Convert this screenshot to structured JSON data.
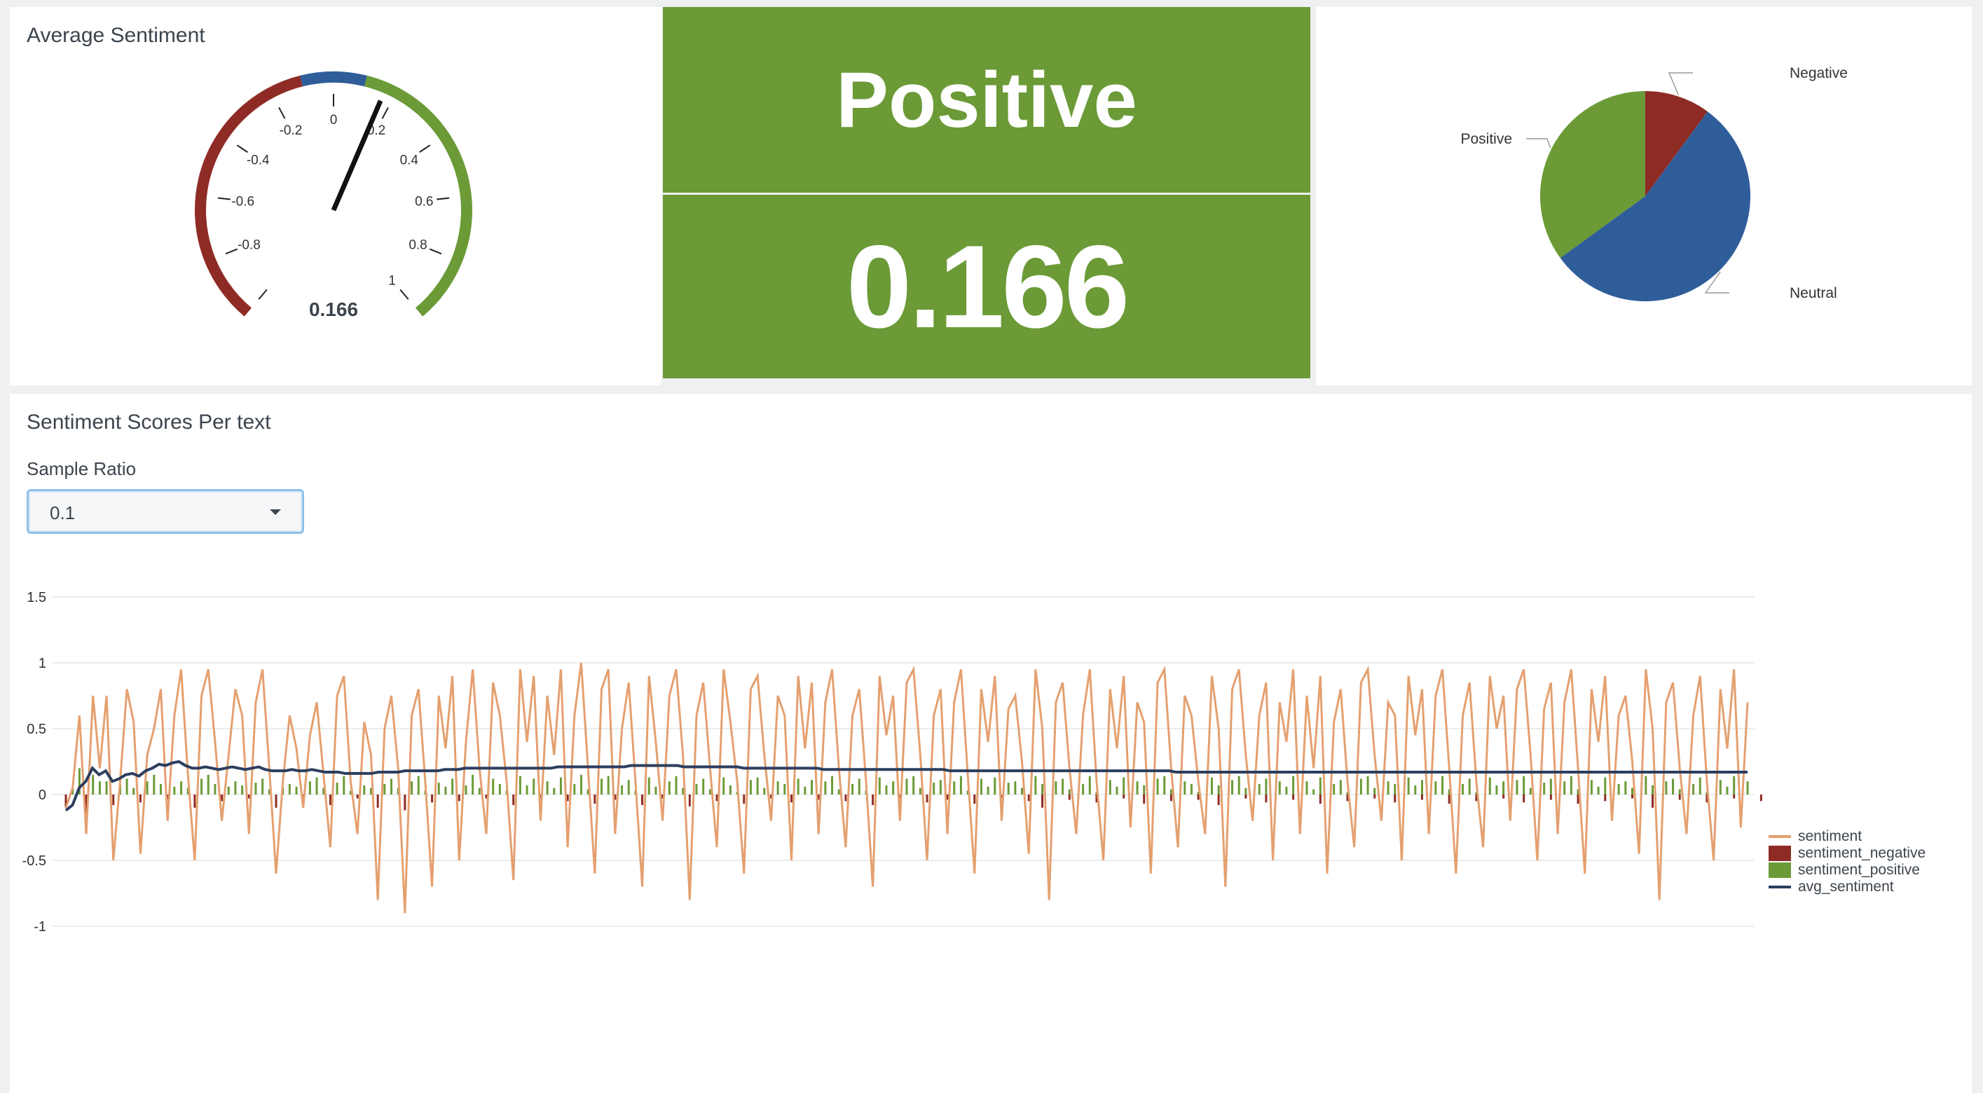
{
  "gauge": {
    "title": "Average Sentiment",
    "value": 0.166,
    "value_label": "0.166",
    "min": -1,
    "max": 1,
    "ticks": [
      "-1",
      "-0.8",
      "-0.6",
      "-0.4",
      "-0.2",
      "0",
      "0.2",
      "0.4",
      "0.6",
      "0.8",
      "1"
    ],
    "bands": [
      {
        "from": -1,
        "to": -0.1,
        "color": "#8f2b25"
      },
      {
        "from": -0.1,
        "to": 0.1,
        "color": "#2f5d9a"
      },
      {
        "from": 0.1,
        "to": 1,
        "color": "#6b9a37"
      }
    ]
  },
  "single_value": {
    "label": "Positive",
    "value": "0.166",
    "color": "#6b9a37"
  },
  "pie": {
    "slices": [
      {
        "label": "Negative",
        "fraction": 0.101,
        "color": "#8f2b25"
      },
      {
        "label": "Neutral",
        "fraction": 0.549,
        "color": "#2f5d9a"
      },
      {
        "label": "Positive",
        "fraction": 0.35,
        "color": "#6b9a37"
      }
    ]
  },
  "timeline": {
    "title": "Sentiment Scores Per text",
    "sample_ratio_label": "Sample Ratio",
    "sample_ratio_value": "0.1"
  },
  "chart_data": {
    "type": "line",
    "y_ticks": [
      "1.5",
      "1",
      "0.5",
      "0",
      "-0.5",
      "-1"
    ],
    "ylim": [
      -1,
      1.5
    ],
    "grid": true,
    "legend_position": "right",
    "series": [
      {
        "name": "sentiment",
        "color": "#e4a06f",
        "type": "line"
      },
      {
        "name": "sentiment_negative",
        "color": "#8f2b25",
        "type": "bar"
      },
      {
        "name": "sentiment_positive",
        "color": "#6b9a37",
        "type": "bar"
      },
      {
        "name": "avg_sentiment",
        "color": "#2c3e5f",
        "type": "line"
      }
    ],
    "sentiment": [
      -0.1,
      0.05,
      0.6,
      -0.3,
      0.75,
      0.2,
      0.75,
      -0.5,
      0.1,
      0.8,
      0.55,
      -0.45,
      0.3,
      0.5,
      0.8,
      -0.2,
      0.6,
      0.95,
      0.15,
      -0.5,
      0.75,
      0.95,
      0.4,
      -0.2,
      0.3,
      0.8,
      0.6,
      -0.3,
      0.7,
      0.95,
      0.2,
      -0.6,
      0.1,
      0.6,
      0.35,
      -0.1,
      0.45,
      0.7,
      0.15,
      -0.4,
      0.75,
      0.9,
      0.1,
      -0.3,
      0.55,
      0.3,
      -0.8,
      0.5,
      0.75,
      0.2,
      -0.9,
      0.6,
      0.8,
      0.1,
      -0.7,
      0.75,
      0.35,
      0.9,
      -0.5,
      0.4,
      0.95,
      0.2,
      -0.3,
      0.85,
      0.6,
      0.1,
      -0.65,
      0.95,
      0.4,
      0.9,
      -0.2,
      0.75,
      0.3,
      0.95,
      -0.4,
      0.6,
      1.0,
      0.2,
      -0.6,
      0.8,
      0.95,
      -0.3,
      0.5,
      0.85,
      0.1,
      -0.7,
      0.9,
      0.4,
      -0.2,
      0.75,
      0.95,
      0.3,
      -0.8,
      0.6,
      0.85,
      0.2,
      -0.4,
      0.95,
      0.55,
      0.1,
      -0.6,
      0.8,
      0.9,
      0.3,
      -0.2,
      0.75,
      0.6,
      -0.5,
      0.9,
      0.35,
      0.85,
      -0.3,
      0.7,
      0.95,
      0.2,
      -0.4,
      0.6,
      0.8,
      0.1,
      -0.7,
      0.9,
      0.45,
      0.75,
      -0.2,
      0.85,
      0.95,
      0.3,
      -0.5,
      0.6,
      0.8,
      -0.3,
      0.7,
      0.95,
      0.15,
      -0.6,
      0.8,
      0.4,
      0.9,
      -0.2,
      0.65,
      0.75,
      0.25,
      -0.45,
      0.95,
      0.5,
      -0.8,
      0.7,
      0.85,
      0.2,
      -0.3,
      0.6,
      0.95,
      0.1,
      -0.5,
      0.8,
      0.35,
      0.9,
      -0.25,
      0.7,
      0.55,
      -0.6,
      0.85,
      0.95,
      0.2,
      -0.4,
      0.75,
      0.6,
      0.1,
      -0.3,
      0.9,
      0.5,
      -0.7,
      0.8,
      0.95,
      0.3,
      -0.2,
      0.6,
      0.85,
      -0.5,
      0.7,
      0.4,
      0.95,
      -0.3,
      0.75,
      0.2,
      0.9,
      -0.6,
      0.55,
      0.8,
      0.1,
      -0.4,
      0.85,
      0.95,
      0.3,
      -0.2,
      0.7,
      0.6,
      -0.5,
      0.9,
      0.45,
      0.8,
      -0.3,
      0.75,
      0.95,
      0.2,
      -0.6,
      0.6,
      0.85,
      0.1,
      -0.4,
      0.9,
      0.5,
      0.75,
      -0.2,
      0.8,
      0.95,
      0.3,
      -0.5,
      0.65,
      0.85,
      -0.3,
      0.7,
      0.95,
      0.2,
      -0.6,
      0.8,
      0.4,
      0.9,
      -0.2,
      0.6,
      0.75,
      0.25,
      -0.45,
      0.95,
      0.5,
      -0.8,
      0.7,
      0.85,
      0.2,
      -0.3,
      0.6,
      0.9,
      0.1,
      -0.5,
      0.8,
      0.35,
      0.95,
      -0.25,
      0.7
    ],
    "negative": [
      -0.1,
      0,
      0,
      -0.15,
      0,
      0,
      0,
      -0.08,
      0,
      0,
      0,
      -0.06,
      0,
      0,
      0,
      -0.04,
      0,
      0,
      0,
      -0.1,
      0,
      0,
      0,
      -0.05,
      0,
      0,
      0,
      -0.03,
      0,
      0,
      0,
      -0.1,
      0,
      0,
      0,
      -0.04,
      0,
      0,
      0,
      -0.08,
      0,
      0,
      0,
      -0.03,
      0,
      0,
      -0.1,
      0,
      0,
      0,
      -0.12,
      0,
      0,
      0,
      -0.06,
      0,
      0,
      0,
      -0.05,
      0,
      0,
      0,
      -0.03,
      0,
      0,
      0,
      -0.08,
      0,
      0,
      0,
      -0.03,
      0,
      0,
      0,
      -0.05,
      0,
      0,
      0,
      -0.07,
      0,
      0,
      -0.04,
      0,
      0,
      0,
      -0.08,
      0,
      0,
      -0.03,
      0,
      0,
      0,
      -0.09,
      0,
      0,
      0,
      -0.05,
      0,
      0,
      0,
      -0.07,
      0,
      0,
      0,
      -0.03,
      0,
      0,
      -0.06,
      0,
      0,
      0,
      -0.04,
      0,
      0,
      0,
      -0.05,
      0,
      0,
      0,
      -0.08,
      0,
      0,
      0,
      -0.03,
      0,
      0,
      0,
      -0.06,
      0,
      0,
      -0.04,
      0,
      0,
      0,
      -0.07,
      0,
      0,
      0,
      -0.03,
      0,
      0,
      0,
      -0.05,
      0,
      -0.1,
      0,
      0,
      0,
      -0.04,
      0,
      0,
      0,
      -0.06,
      0,
      0,
      0,
      -0.03,
      0,
      0,
      -0.07,
      0,
      0,
      0,
      -0.05,
      0,
      0,
      0,
      -0.04,
      0,
      0,
      -0.08,
      0,
      0,
      0,
      -0.03,
      0,
      0,
      -0.06,
      0,
      0,
      0,
      -0.04,
      0,
      0,
      0,
      -0.07,
      0,
      0,
      0,
      -0.05,
      0,
      0,
      0,
      -0.03,
      0,
      0,
      -0.06,
      0,
      0,
      0,
      -0.04,
      0,
      0,
      0,
      -0.07,
      0,
      0,
      0,
      -0.05,
      0,
      0,
      0,
      -0.03,
      0,
      0,
      -0.06,
      0,
      0,
      0,
      -0.04,
      0,
      0,
      0,
      -0.07,
      0,
      0,
      0,
      -0.05,
      0,
      0,
      0,
      -0.03,
      0,
      0,
      -0.1,
      0,
      0,
      0,
      -0.04,
      0,
      0,
      0,
      -0.06,
      0,
      0,
      0,
      -0.03,
      0,
      0,
      0,
      -0.05,
      0
    ],
    "positive": [
      0,
      0.05,
      0.2,
      0,
      0.15,
      0.1,
      0.1,
      0,
      0.08,
      0.12,
      0.05,
      0,
      0.1,
      0.15,
      0.08,
      0,
      0.06,
      0.1,
      0.05,
      0,
      0.12,
      0.15,
      0.08,
      0,
      0.06,
      0.1,
      0.07,
      0,
      0.09,
      0.12,
      0.04,
      0,
      0.05,
      0.08,
      0.06,
      0,
      0.1,
      0.13,
      0.05,
      0,
      0.09,
      0.14,
      0.03,
      0,
      0.07,
      0.05,
      0,
      0.08,
      0.12,
      0.05,
      0,
      0.1,
      0.14,
      0.03,
      0,
      0.09,
      0.06,
      0.12,
      0,
      0.07,
      0.15,
      0.05,
      0,
      0.12,
      0.08,
      0.03,
      0,
      0.14,
      0.07,
      0.12,
      0,
      0.1,
      0.05,
      0.13,
      0,
      0.08,
      0.15,
      0.04,
      0,
      0.12,
      0.14,
      0,
      0.07,
      0.11,
      0.03,
      0,
      0.13,
      0.06,
      0,
      0.1,
      0.14,
      0.05,
      0,
      0.08,
      0.12,
      0.04,
      0,
      0.13,
      0.07,
      0.02,
      0,
      0.11,
      0.13,
      0.05,
      0,
      0.1,
      0.08,
      0,
      0.12,
      0.06,
      0.11,
      0,
      0.1,
      0.14,
      0.04,
      0,
      0.08,
      0.12,
      0.03,
      0,
      0.13,
      0.07,
      0.1,
      0,
      0.12,
      0.14,
      0.05,
      0,
      0.09,
      0.11,
      0,
      0.1,
      0.14,
      0.03,
      0,
      0.12,
      0.06,
      0.13,
      0,
      0.09,
      0.1,
      0.05,
      0,
      0.14,
      0.08,
      0,
      0.1,
      0.12,
      0.04,
      0,
      0.08,
      0.14,
      0.02,
      0,
      0.11,
      0.06,
      0.13,
      0,
      0.1,
      0.07,
      0,
      0.12,
      0.14,
      0.04,
      0,
      0.1,
      0.08,
      0.02,
      0,
      0.13,
      0.07,
      0,
      0.11,
      0.14,
      0.05,
      0,
      0.08,
      0.12,
      0,
      0.1,
      0.06,
      0.14,
      0,
      0.1,
      0.04,
      0.13,
      0,
      0.08,
      0.11,
      0.02,
      0,
      0.12,
      0.14,
      0.05,
      0,
      0.1,
      0.08,
      0,
      0.13,
      0.07,
      0.11,
      0,
      0.1,
      0.14,
      0.04,
      0,
      0.08,
      0.12,
      0.02,
      0,
      0.13,
      0.07,
      0.1,
      0,
      0.11,
      0.14,
      0.05,
      0,
      0.09,
      0.12,
      0,
      0.1,
      0.14,
      0.04,
      0,
      0.11,
      0.06,
      0.13,
      0,
      0.08,
      0.1,
      0.05,
      0,
      0.14,
      0.07,
      0,
      0.1,
      0.12,
      0.04,
      0,
      0.08,
      0.13,
      0.02,
      0,
      0.11,
      0.06,
      0.14,
      0,
      0.1
    ],
    "avg_sentiment": [
      -0.12,
      -0.08,
      0.05,
      0.1,
      0.2,
      0.15,
      0.18,
      0.1,
      0.12,
      0.15,
      0.16,
      0.14,
      0.18,
      0.2,
      0.23,
      0.22,
      0.24,
      0.25,
      0.22,
      0.2,
      0.2,
      0.21,
      0.2,
      0.19,
      0.2,
      0.21,
      0.2,
      0.19,
      0.2,
      0.21,
      0.19,
      0.18,
      0.18,
      0.18,
      0.19,
      0.18,
      0.18,
      0.19,
      0.18,
      0.17,
      0.17,
      0.17,
      0.16,
      0.16,
      0.16,
      0.16,
      0.16,
      0.17,
      0.17,
      0.17,
      0.17,
      0.18,
      0.18,
      0.18,
      0.18,
      0.18,
      0.18,
      0.19,
      0.19,
      0.19,
      0.2,
      0.2,
      0.2,
      0.2,
      0.2,
      0.2,
      0.2,
      0.2,
      0.2,
      0.2,
      0.2,
      0.2,
      0.2,
      0.2,
      0.21,
      0.21,
      0.21,
      0.21,
      0.21,
      0.21,
      0.21,
      0.21,
      0.21,
      0.21,
      0.21,
      0.22,
      0.22,
      0.22,
      0.22,
      0.22,
      0.22,
      0.22,
      0.22,
      0.21,
      0.21,
      0.21,
      0.21,
      0.21,
      0.21,
      0.21,
      0.21,
      0.21,
      0.2,
      0.2,
      0.2,
      0.2,
      0.2,
      0.2,
      0.2,
      0.2,
      0.2,
      0.2,
      0.2,
      0.2,
      0.19,
      0.19,
      0.19,
      0.19,
      0.19,
      0.19,
      0.19,
      0.19,
      0.19,
      0.19,
      0.19,
      0.19,
      0.19,
      0.19,
      0.19,
      0.19,
      0.19,
      0.19,
      0.19,
      0.18,
      0.18,
      0.18,
      0.18,
      0.18,
      0.18,
      0.18,
      0.18,
      0.18,
      0.18,
      0.18,
      0.18,
      0.18,
      0.18,
      0.18,
      0.18,
      0.18,
      0.18,
      0.18,
      0.18,
      0.18,
      0.18,
      0.18,
      0.18,
      0.18,
      0.18,
      0.18,
      0.18,
      0.18,
      0.18,
      0.18,
      0.18,
      0.18,
      0.18,
      0.17,
      0.17,
      0.17,
      0.17,
      0.17,
      0.17,
      0.17,
      0.17,
      0.17,
      0.17,
      0.17,
      0.17,
      0.17,
      0.17,
      0.17,
      0.17,
      0.17,
      0.17,
      0.17,
      0.17,
      0.17,
      0.17,
      0.17,
      0.17,
      0.17,
      0.17,
      0.17,
      0.17,
      0.17,
      0.17,
      0.17,
      0.17,
      0.17,
      0.17,
      0.17,
      0.17,
      0.17,
      0.17,
      0.17,
      0.17,
      0.17,
      0.17,
      0.17,
      0.17,
      0.17,
      0.17,
      0.17,
      0.17,
      0.17,
      0.17,
      0.17,
      0.17,
      0.17,
      0.17,
      0.17,
      0.17,
      0.17,
      0.17,
      0.17,
      0.17,
      0.17,
      0.17,
      0.17,
      0.17,
      0.17,
      0.17,
      0.17,
      0.17,
      0.17,
      0.17,
      0.17,
      0.17,
      0.17,
      0.17,
      0.17,
      0.17,
      0.17,
      0.17,
      0.17,
      0.17,
      0.17,
      0.17,
      0.17,
      0.17,
      0.17,
      0.17,
      0.17
    ]
  }
}
